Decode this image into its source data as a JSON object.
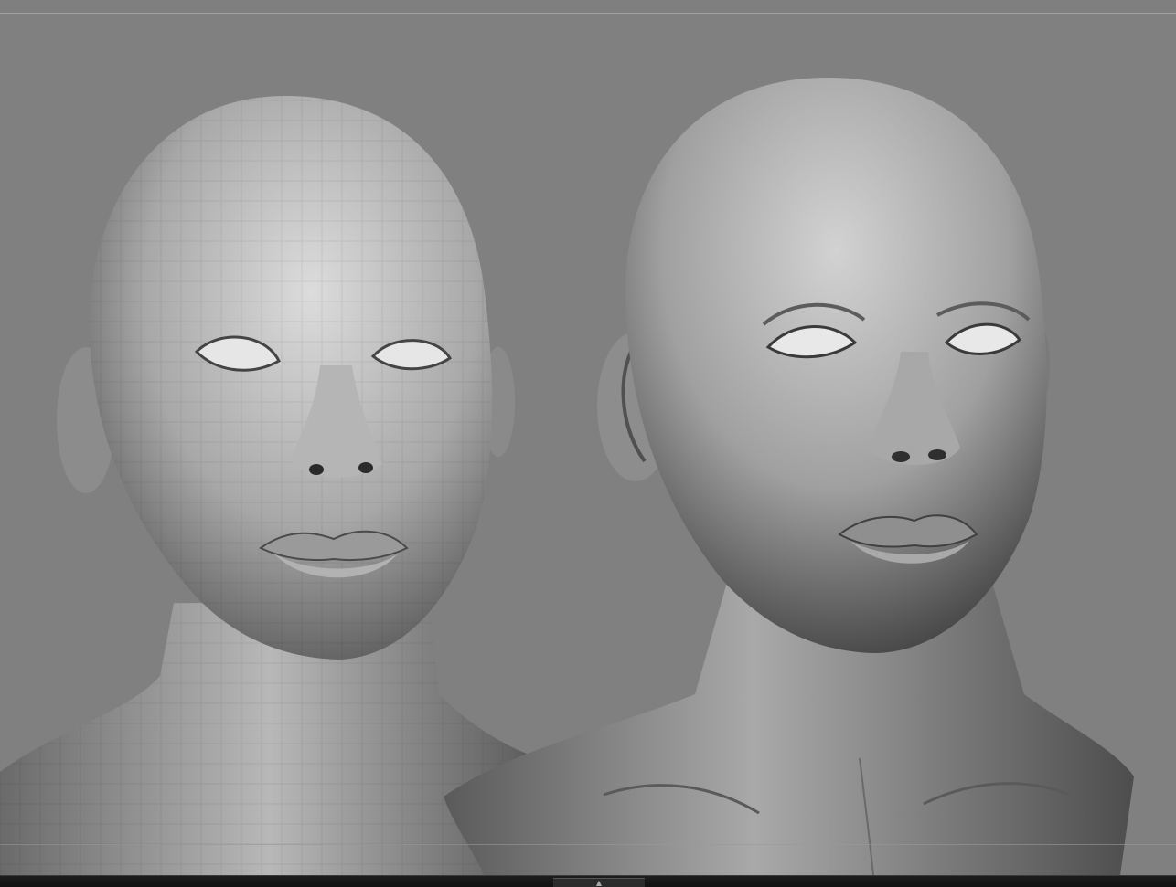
{
  "viewport": {
    "background": "#808080",
    "models": [
      {
        "icon": "lowpoly-head-model",
        "shading": "faceted"
      },
      {
        "icon": "sculpted-head-model",
        "shading": "smooth"
      }
    ]
  },
  "statusbar": {
    "handle_icon": "collapse-triangle-icon",
    "handle_glyph": "▲"
  }
}
